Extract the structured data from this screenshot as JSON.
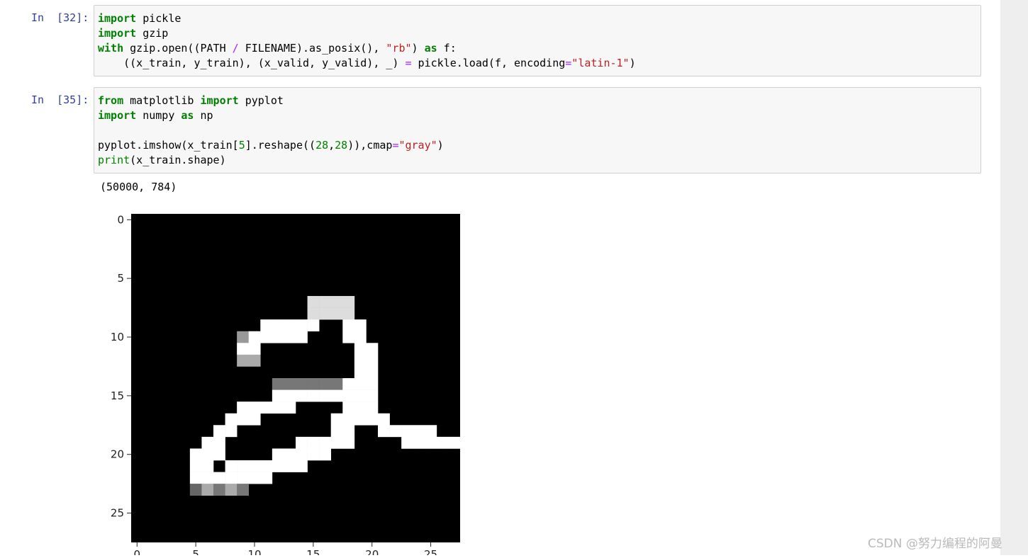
{
  "cells": [
    {
      "prompt": "In  [32]:",
      "lines": [
        [
          [
            "kw",
            "import"
          ],
          [
            "t",
            " pickle"
          ]
        ],
        [
          [
            "kw",
            "import"
          ],
          [
            "t",
            " gzip"
          ]
        ],
        [
          [
            "kw",
            "with"
          ],
          [
            "t",
            " gzip.open((PATH "
          ],
          [
            "op",
            "/"
          ],
          [
            "t",
            " FILENAME).as_posix(), "
          ],
          [
            "st",
            "\"rb\""
          ],
          [
            "t",
            ") "
          ],
          [
            "kw",
            "as"
          ],
          [
            "t",
            " f:"
          ]
        ],
        [
          [
            "t",
            "    ((x_train, y_train), (x_valid, y_valid), _) "
          ],
          [
            "op",
            "="
          ],
          [
            "t",
            " pickle.load(f, encoding"
          ],
          [
            "op",
            "="
          ],
          [
            "st",
            "\"latin-1\""
          ],
          [
            "t",
            ")"
          ]
        ]
      ]
    },
    {
      "prompt": "In  [35]:",
      "lines": [
        [
          [
            "kw",
            "from"
          ],
          [
            "t",
            " matplotlib "
          ],
          [
            "kw",
            "import"
          ],
          [
            "t",
            " pyplot"
          ]
        ],
        [
          [
            "kw",
            "import"
          ],
          [
            "t",
            " numpy "
          ],
          [
            "kw",
            "as"
          ],
          [
            "t",
            " np"
          ]
        ],
        [
          [
            "t",
            ""
          ]
        ],
        [
          [
            "t",
            "pyplot.imshow(x_train["
          ],
          [
            "nm",
            "5"
          ],
          [
            "t",
            "].reshape(("
          ],
          [
            "nm",
            "28"
          ],
          [
            "t",
            ","
          ],
          [
            "nm",
            "28"
          ],
          [
            "t",
            ")),cmap"
          ],
          [
            "op",
            "="
          ],
          [
            "st",
            "\"gray\""
          ],
          [
            "t",
            ")"
          ]
        ],
        [
          [
            "bi",
            "print"
          ],
          [
            "t",
            "(x_train.shape)"
          ]
        ]
      ]
    }
  ],
  "output": {
    "text": "(50000, 784)"
  },
  "plot": {
    "y_ticks": [
      "0",
      "5",
      "10",
      "15",
      "20",
      "25"
    ],
    "x_ticks": [
      "0",
      "5",
      "10",
      "15",
      "20",
      "25"
    ],
    "colormap": "gray",
    "rows": 28,
    "cols": 28,
    "pixels": [
      "0000000000000000000000000000",
      "0000000000000000000000000000",
      "0000000000000000000000000000",
      "0000000000000000000000000000",
      "0000000000000000000000000000",
      "0000000000000000000000000000",
      "0000000000000000000000000000",
      "000000000000000dddd000000000",
      "000000000000000dddd000000000",
      "00000000000fffff00ff00000000",
      "0000000009fffff000ff00000000",
      "000000000ff00000000ff0000000",
      "000000000aa00000000ff0000000",
      "0000000000000000000ff0000000",
      "000000000000777777fff0000000",
      "000000000000fffffffff0000000",
      "000000000fffff0000fff0000000",
      "00000000fff000000fffff000000",
      "0000000ff00000000ff00fffff00",
      "000000ff000000fffff0000fffff",
      "00000fff0000fffff00000000000",
      "00000ff0fffffff0000000000000",
      "00000fffffff000000000000000",
      "000006a7a7000000000000000000",
      "0000000000000000000000000000",
      "0000000000000000000000000000",
      "0000000000000000000000000000",
      "0000000000000000000000000000"
    ]
  },
  "watermark": "CSDN @努力编程的阿曼",
  "colors": {
    "prompt": "#303f9f",
    "keyword": "#008000",
    "string": "#ba2121",
    "operator": "#aa22ff",
    "cell_bg": "#f7f7f7",
    "cell_border": "#cfcfcf",
    "scrollbar": "#eeeeee"
  }
}
